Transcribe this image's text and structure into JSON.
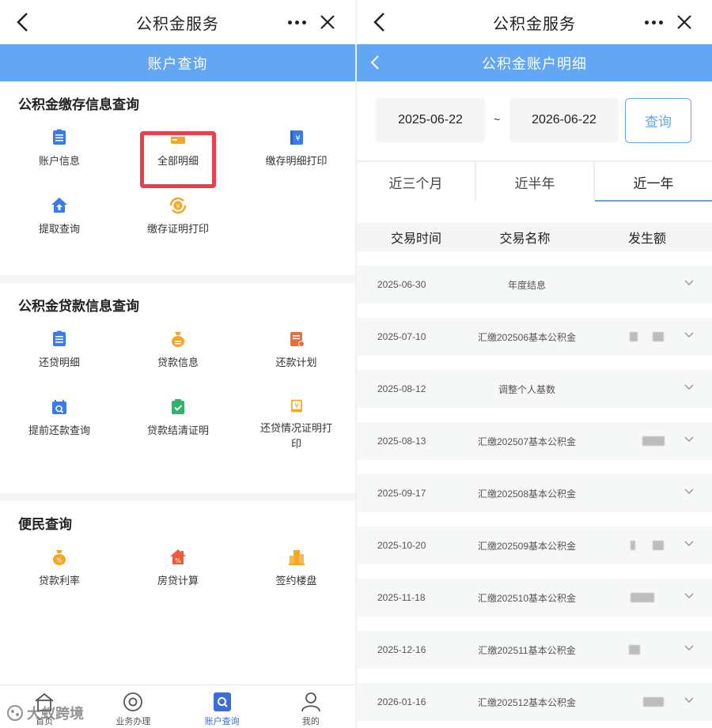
{
  "left": {
    "app_title": "公积金服务",
    "sub_title": "账户查询",
    "sections": [
      {
        "title": "公积金缴存信息查询",
        "items": [
          {
            "label": "账户信息",
            "icon": "document-list-icon",
            "color": "#3b7be8"
          },
          {
            "label": "全部明细",
            "icon": "card-icon",
            "color": "#f5a623"
          },
          {
            "label": "缴存明细打印",
            "icon": "yuan-book-icon",
            "color": "#3b7be8"
          },
          {
            "label": "提取查询",
            "icon": "upload-home-icon",
            "color": "#3b7be8"
          },
          {
            "label": "缴存证明打印",
            "icon": "yuan-refresh-icon",
            "color": "#f5a623"
          }
        ]
      },
      {
        "title": "公积金贷款信息查询",
        "items": [
          {
            "label": "还贷明细",
            "icon": "document-list-icon",
            "color": "#3b7be8"
          },
          {
            "label": "贷款信息",
            "icon": "money-bag-icon",
            "color": "#f5a623"
          },
          {
            "label": "还款计划",
            "icon": "plan-doc-icon",
            "color": "#ef6b3a"
          },
          {
            "label": "提前还款查询",
            "icon": "calendar-search-icon",
            "color": "#3b7be8"
          },
          {
            "label": "贷款结清证明",
            "icon": "check-clipboard-icon",
            "color": "#2fb36b"
          },
          {
            "label": "还贷情况证明打印",
            "icon": "yuan-certificate-icon",
            "color": "#f5a623"
          }
        ]
      },
      {
        "title": "便民查询",
        "items": [
          {
            "label": "贷款利率",
            "icon": "percent-bag-icon",
            "color": "#f5a623"
          },
          {
            "label": "房贷计算",
            "icon": "house-percent-icon",
            "color": "#ef5b3a"
          },
          {
            "label": "签约楼盘",
            "icon": "building-icon",
            "color": "#f5a623"
          }
        ]
      }
    ],
    "bottom_nav": [
      {
        "label": "首页",
        "icon": "home-icon"
      },
      {
        "label": "业务办理",
        "icon": "target-icon"
      },
      {
        "label": "账户查询",
        "icon": "account-search-icon",
        "active": true
      },
      {
        "label": "我的",
        "icon": "user-icon"
      }
    ],
    "watermark": "大蚁跨境"
  },
  "right": {
    "app_title": "公积金服务",
    "sub_title": "公积金账户明细",
    "date_start": "2025-06-22",
    "date_sep": "~",
    "date_end": "2026-06-22",
    "query_label": "查询",
    "tabs": [
      {
        "label": "近三个月"
      },
      {
        "label": "近半年"
      },
      {
        "label": "近一年",
        "active": true
      }
    ],
    "columns": [
      "交易时间",
      "交易名称",
      "发生额"
    ],
    "rows": [
      {
        "date": "2025-06-30",
        "name": "年度结息"
      },
      {
        "date": "2025-07-10",
        "name": "汇缴202506基本公积金"
      },
      {
        "date": "2025-08-12",
        "name": "调整个人基数"
      },
      {
        "date": "2025-08-13",
        "name": "汇缴202507基本公积金"
      },
      {
        "date": "2025-09-17",
        "name": "汇缴202508基本公积金"
      },
      {
        "date": "2025-10-20",
        "name": "汇缴202509基本公积金"
      },
      {
        "date": "2025-11-18",
        "name": "汇缴202510基本公积金"
      },
      {
        "date": "2025-12-16",
        "name": "汇缴202511基本公积金"
      },
      {
        "date": "2026-01-16",
        "name": "汇缴202512基本公积金"
      }
    ]
  },
  "colors": {
    "accent": "#63a6f3",
    "highlight": "#e8414b",
    "active_nav": "#3b6fd6"
  }
}
